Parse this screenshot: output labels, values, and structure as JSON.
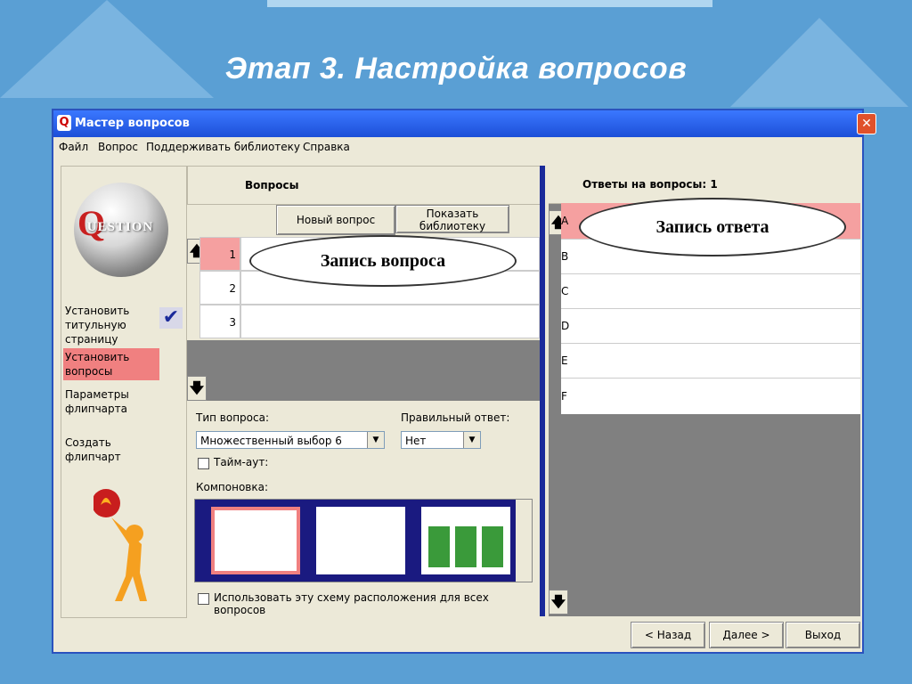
{
  "slide": {
    "title": "Этап 3. Настройка вопросов"
  },
  "window": {
    "title": "Мастер вопросов",
    "close_icon": "close-icon"
  },
  "menu": [
    "Файл",
    "Вопрос",
    "Поддерживать библиотеку",
    "Справка"
  ],
  "logo": {
    "letter": "Q",
    "text": "UESTION"
  },
  "steps": [
    {
      "label": "Установить титульную страницу",
      "active": false,
      "done": true
    },
    {
      "label": "Установить вопросы",
      "active": true,
      "done": false
    },
    {
      "label": "Параметры флипчарта",
      "active": false,
      "done": false
    },
    {
      "label": "Создать флипчарт",
      "active": false,
      "done": false
    }
  ],
  "questions": {
    "header": "Вопросы",
    "new_button": "Новый вопрос",
    "library_button": "Показать библиотеку",
    "rows": [
      "1",
      "2",
      "3"
    ],
    "callout": "Запись вопроса"
  },
  "answers": {
    "header": "Ответы на вопросы: 1",
    "rows": [
      "A",
      "B",
      "C",
      "D",
      "E",
      "F"
    ],
    "callout": "Запись ответа"
  },
  "settings": {
    "type_label": "Тип вопроса:",
    "type_value": "Множественный выбор 6",
    "correct_label": "Правильный ответ:",
    "correct_value": "Нет",
    "timeout_label": "Тайм-аут:",
    "layout_label": "Компоновка:",
    "use_layout_label": "Использовать эту схему расположения для всех вопросов"
  },
  "footer": {
    "back": "< Назад",
    "next": "Далее >",
    "exit": "Выход"
  },
  "colors": {
    "accent": "#f08080",
    "titlebar": "#1c4fd8",
    "background": "#5a9fd4"
  }
}
